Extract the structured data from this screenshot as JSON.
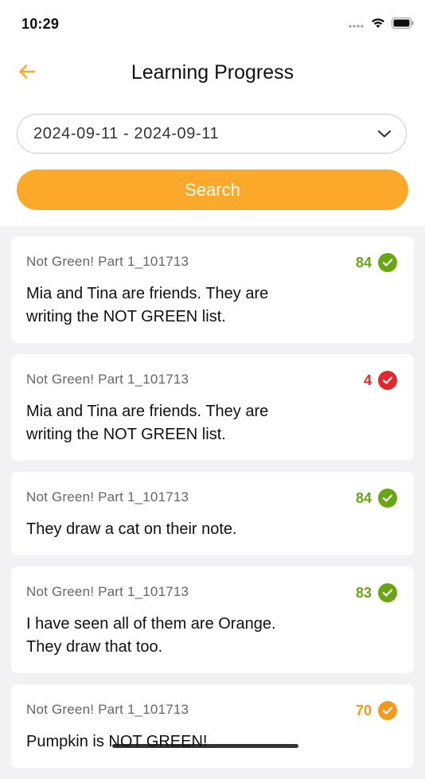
{
  "status_bar": {
    "time": "10:29"
  },
  "nav": {
    "title": "Learning Progress",
    "back_icon": "arrow-left-icon"
  },
  "filter": {
    "date_range": "2024-09-11 - 2024-09-11",
    "search_label": "Search"
  },
  "colors": {
    "accent": "#fba82b",
    "score_green": "#6aa513",
    "score_red": "#e0282e",
    "score_orange": "#f39a1e"
  },
  "records": [
    {
      "title": "Not Green! Part 1_101713",
      "text": "Mia and Tina are friends.   They are\nwriting the NOT GREEN list.",
      "score": "84",
      "status": "green"
    },
    {
      "title": "Not Green! Part 1_101713",
      "text": "Mia and Tina are friends.   They are\nwriting the NOT GREEN list.",
      "score": "4",
      "status": "red"
    },
    {
      "title": "Not Green! Part 1_101713",
      "text": "They draw a cat on their note.",
      "score": "84",
      "status": "green"
    },
    {
      "title": "Not Green! Part 1_101713",
      "text": "I have seen all of them are Orange.\nThey draw that too.",
      "score": "83",
      "status": "green"
    },
    {
      "title": "Not Green! Part 1_101713",
      "text": "Pumpkin is NOT GREEN!",
      "score": "70",
      "status": "orange"
    }
  ]
}
